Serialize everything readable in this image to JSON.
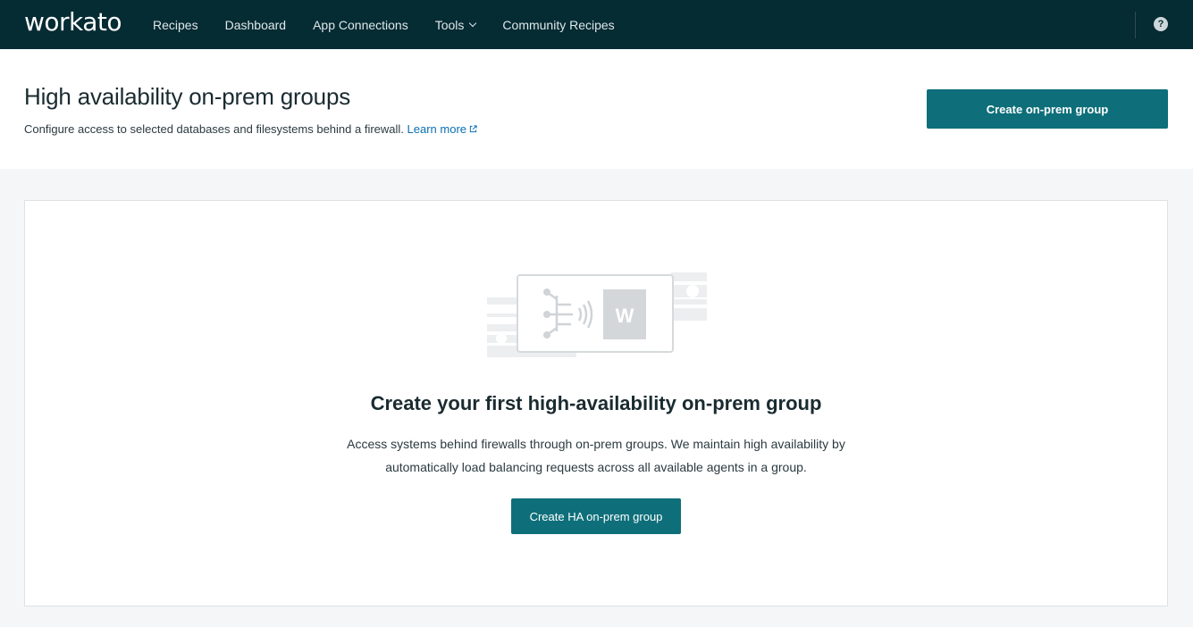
{
  "nav": {
    "logo": "workato",
    "items": [
      "Recipes",
      "Dashboard",
      "App Connections",
      "Tools",
      "Community Recipes"
    ],
    "help_label": "?"
  },
  "header": {
    "title": "High availability on-prem groups",
    "subtitle": "Configure access to selected databases and filesystems behind a firewall.",
    "learn_more": "Learn more",
    "create_button": "Create on-prem group"
  },
  "empty_state": {
    "illustration_icon": "workato-agent-illustration",
    "illustration_letter": "W",
    "title": "Create your first high-availability on-prem group",
    "description_line1": "Access systems behind firewalls through on-prem groups. We maintain high availability by",
    "description_line2": "automatically load balancing requests across all available agents in a group.",
    "button": "Create HA on-prem group"
  },
  "colors": {
    "nav_bg": "#052b33",
    "accent": "#0e6f7a",
    "link": "#0b6fb3",
    "page_bg": "#f5f6f7"
  }
}
